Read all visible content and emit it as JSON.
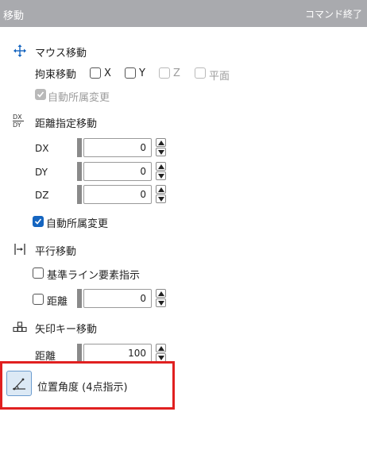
{
  "titlebar": {
    "title": "移動",
    "end_command": "コマンド終了"
  },
  "mouse_move": {
    "label": "マウス移動",
    "constraint_label": "拘束移動",
    "x_label": "X",
    "y_label": "Y",
    "z_label": "Z",
    "plane_label": "平面",
    "auto_change_label": "自動所属変更"
  },
  "distance_move": {
    "label": "距離指定移動",
    "icon_text_top": "DX",
    "icon_text_bottom": "DY",
    "dx_label": "DX",
    "dx_value": "0",
    "dy_label": "DY",
    "dy_value": "0",
    "dz_label": "DZ",
    "dz_value": "0",
    "auto_change_label": "自動所属変更"
  },
  "parallel_move": {
    "label": "平行移動",
    "base_line_label": "基準ライン要素指示",
    "distance_label": "距離",
    "distance_value": "0"
  },
  "arrow_key_move": {
    "label": "矢印キー移動",
    "distance_label": "距離",
    "distance_value": "100"
  },
  "position_angle": {
    "label": "位置角度 (4点指示)"
  },
  "colors": {
    "accent": "#1565c0",
    "highlight": "#e02020",
    "titlebar": "#a9aaae"
  }
}
